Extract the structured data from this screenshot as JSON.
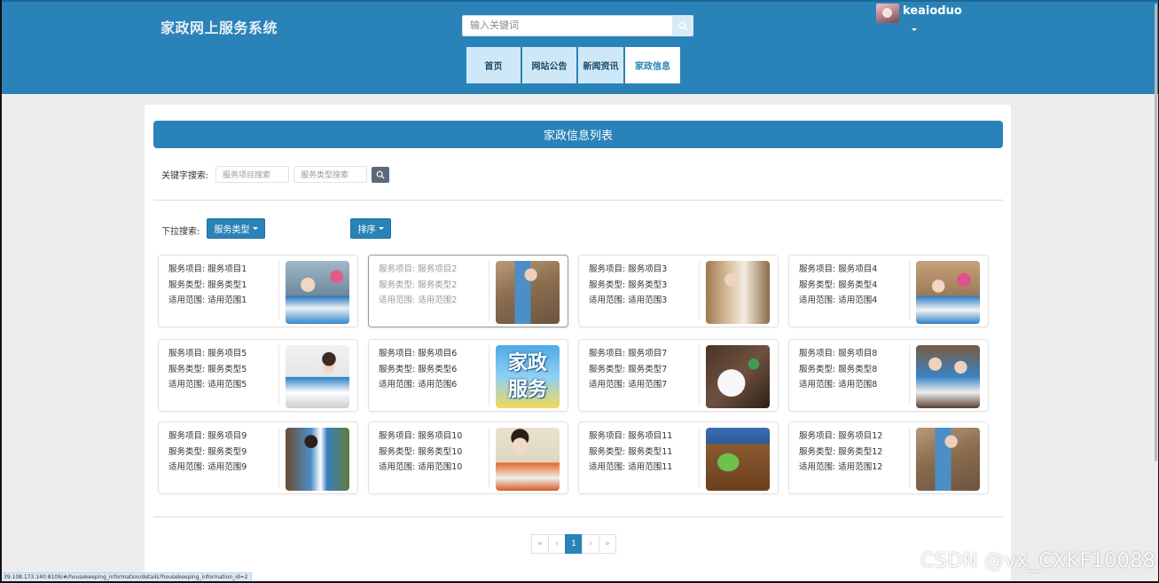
{
  "header": {
    "site_title": "家政网上服务系统",
    "search_placeholder": "输入关键词",
    "username": "keaioduo",
    "nav": [
      "首页",
      "网站公告",
      "新闻资讯",
      "家政信息"
    ],
    "active_nav": "家政信息"
  },
  "main": {
    "list_title": "家政信息列表",
    "keyword_label": "关键字搜索:",
    "keyword_placeholders": [
      "服务项目搜索",
      "服务类型搜索"
    ],
    "dropdown_label": "下拉搜索:",
    "dropdown_service_type": "服务类型",
    "dropdown_sort": "排序"
  },
  "field_labels": {
    "item": "服务项目:",
    "type": "服务类型:",
    "scope": "适用范围:"
  },
  "cards": [
    {
      "item": "服务项目1",
      "type": "服务类型1",
      "scope": "适用范围1"
    },
    {
      "item": "服务项目2",
      "type": "服务类型2",
      "scope": "适用范围2"
    },
    {
      "item": "服务项目3",
      "type": "服务类型3",
      "scope": "适用范围3"
    },
    {
      "item": "服务项目4",
      "type": "服务类型4",
      "scope": "适用范围4"
    },
    {
      "item": "服务项目5",
      "type": "服务类型5",
      "scope": "适用范围5"
    },
    {
      "item": "服务项目6",
      "type": "服务类型6",
      "scope": "适用范围6",
      "image_text": [
        "家政",
        "服务"
      ]
    },
    {
      "item": "服务项目7",
      "type": "服务类型7",
      "scope": "适用范围7"
    },
    {
      "item": "服务项目8",
      "type": "服务类型8",
      "scope": "适用范围8"
    },
    {
      "item": "服务项目9",
      "type": "服务类型9",
      "scope": "适用范围9"
    },
    {
      "item": "服务项目10",
      "type": "服务类型10",
      "scope": "适用范围10"
    },
    {
      "item": "服务项目11",
      "type": "服务类型11",
      "scope": "适用范围11"
    },
    {
      "item": "服务项目12",
      "type": "服务类型12",
      "scope": "适用范围12"
    }
  ],
  "pagination": {
    "first": "«",
    "prev": "‹",
    "current": "1",
    "next": "›",
    "last": "»"
  },
  "status_url": "39.108.173.140:8109/#/housekeeping_information/details?housekeeping_information_id=2",
  "watermark": "CSDN @vx_CXKF10088",
  "colors": {
    "primary": "#2a83b8",
    "nav_tab": "#cfe8f7",
    "page_bg": "#ececec"
  }
}
